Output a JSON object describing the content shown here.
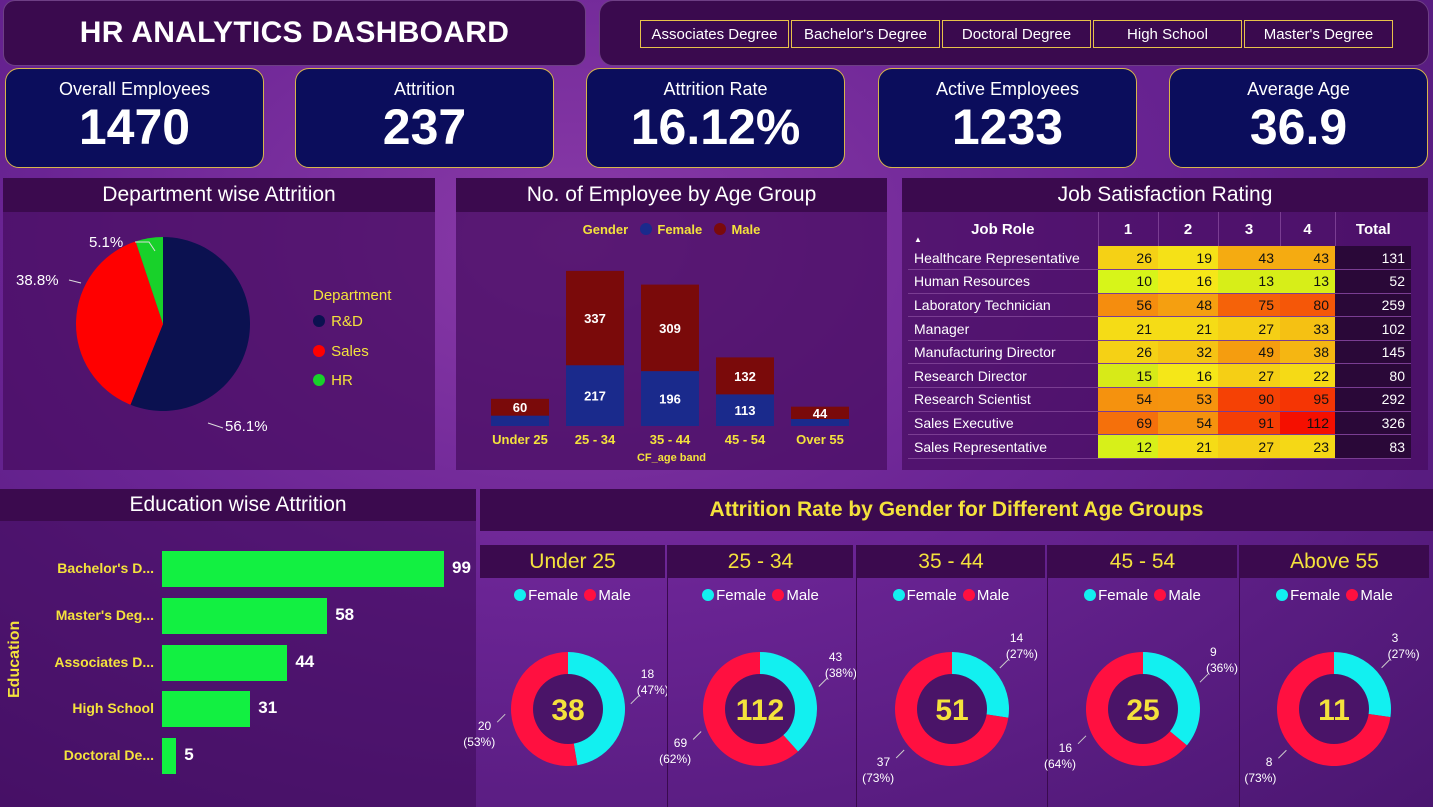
{
  "header": {
    "title": "HR ANALYTICS DASHBOARD",
    "slicer": [
      "Associates Degree",
      "Bachelor's Degree",
      "Doctoral Degree",
      "High School",
      "Master's Degree"
    ]
  },
  "kpis": [
    {
      "label": "Overall Employees",
      "value": "1470"
    },
    {
      "label": "Attrition",
      "value": "237"
    },
    {
      "label": "Attrition Rate",
      "value": "16.12%"
    },
    {
      "label": "Active Employees",
      "value": "1233"
    },
    {
      "label": "Average Age",
      "value": "36.9"
    }
  ],
  "dept": {
    "title": "Department wise Attrition",
    "legend_title": "Department",
    "colors": {
      "R&D": "#0b1150",
      "Sales": "#ff0000",
      "HR": "#18d12a"
    },
    "labels": {
      "rd": "56.1%",
      "sales": "38.8%",
      "hr": "5.1%"
    }
  },
  "age": {
    "title": "No. of Employee by Age Group",
    "legend_title": "Gender",
    "legend_female": "Female",
    "legend_male": "Male",
    "xlabel": "CF_age band",
    "colors": {
      "female": "#1a2a8c",
      "male": "#7a0a0a"
    }
  },
  "job": {
    "title": "Job Satisfaction Rating",
    "headers": [
      "Job Role",
      "1",
      "2",
      "3",
      "4",
      "Total"
    ],
    "rows": [
      {
        "role": "Healthcare Representative",
        "v": [
          26,
          19,
          43,
          43
        ],
        "t": 131
      },
      {
        "role": "Human Resources",
        "v": [
          10,
          16,
          13,
          13
        ],
        "t": 52
      },
      {
        "role": "Laboratory Technician",
        "v": [
          56,
          48,
          75,
          80
        ],
        "t": 259
      },
      {
        "role": "Manager",
        "v": [
          21,
          21,
          27,
          33
        ],
        "t": 102
      },
      {
        "role": "Manufacturing Director",
        "v": [
          26,
          32,
          49,
          38
        ],
        "t": 145
      },
      {
        "role": "Research Director",
        "v": [
          15,
          16,
          27,
          22
        ],
        "t": 80
      },
      {
        "role": "Research Scientist",
        "v": [
          54,
          53,
          90,
          95
        ],
        "t": 292
      },
      {
        "role": "Sales Executive",
        "v": [
          69,
          54,
          91,
          112
        ],
        "t": 326
      },
      {
        "role": "Sales Representative",
        "v": [
          12,
          21,
          27,
          23
        ],
        "t": 83
      }
    ]
  },
  "edu": {
    "title": "Education wise Attrition",
    "axis_label": "Education",
    "rows": [
      {
        "label": "Bachelor's D...",
        "value": 99
      },
      {
        "label": "Master's Deg...",
        "value": 58
      },
      {
        "label": "Associates D...",
        "value": 44
      },
      {
        "label": "High School",
        "value": 31
      },
      {
        "label": "Doctoral De...",
        "value": 5
      }
    ]
  },
  "gender": {
    "title": "Attrition Rate by Gender for Different Age Groups",
    "legend_female": "Female",
    "legend_male": "Male",
    "colors": {
      "female": "#12f0f0",
      "male": "#ff1040"
    },
    "groups": [
      {
        "name": "Under 25",
        "total": "38",
        "female_lbl": "18",
        "female_pct": "(47%)",
        "male_lbl": "20",
        "male_pct": "(53%)"
      },
      {
        "name": "25 - 34",
        "total": "112",
        "female_lbl": "43",
        "female_pct": "(38%)",
        "male_lbl": "69",
        "male_pct": "(62%)"
      },
      {
        "name": "35 - 44",
        "total": "51",
        "female_lbl": "14",
        "female_pct": "(27%)",
        "male_lbl": "37",
        "male_pct": "(73%)"
      },
      {
        "name": "45 - 54",
        "total": "25",
        "female_lbl": "9",
        "female_pct": "(36%)",
        "male_lbl": "16",
        "male_pct": "(64%)"
      },
      {
        "name": "Above 55",
        "total": "11",
        "female_lbl": "3",
        "female_pct": "(27%)",
        "male_lbl": "8",
        "male_pct": "(73%)"
      }
    ]
  },
  "chart_data": [
    {
      "type": "pie",
      "title": "Department wise Attrition",
      "categories": [
        "R&D",
        "Sales",
        "HR"
      ],
      "values": [
        56.1,
        38.8,
        5.1
      ],
      "legend": "right"
    },
    {
      "type": "bar",
      "title": "No. of Employee by Age Group",
      "xlabel": "CF_age band",
      "categories": [
        "Under 25",
        "25 - 34",
        "35 - 44",
        "45 - 54",
        "Over 55"
      ],
      "series": [
        {
          "name": "Female",
          "values": [
            37,
            217,
            196,
            113,
            25
          ]
        },
        {
          "name": "Male",
          "values": [
            60,
            337,
            309,
            132,
            44
          ]
        }
      ],
      "stacked": true,
      "legend": "top"
    },
    {
      "type": "bar",
      "title": "Education wise Attrition",
      "ylabel": "Education",
      "orientation": "horizontal",
      "categories": [
        "Bachelor's D...",
        "Master's Deg...",
        "Associates D...",
        "High School",
        "Doctoral De..."
      ],
      "values": [
        99,
        58,
        44,
        31,
        5
      ]
    },
    {
      "type": "pie",
      "title": "Attrition Rate by Gender for Different Age Groups",
      "categories": [
        "Under 25",
        "25 - 34",
        "35 - 44",
        "45 - 54",
        "Above 55"
      ],
      "series": [
        {
          "name": "Female",
          "values": [
            18,
            43,
            14,
            9,
            3
          ]
        },
        {
          "name": "Male",
          "values": [
            20,
            69,
            37,
            16,
            8
          ]
        }
      ]
    }
  ]
}
